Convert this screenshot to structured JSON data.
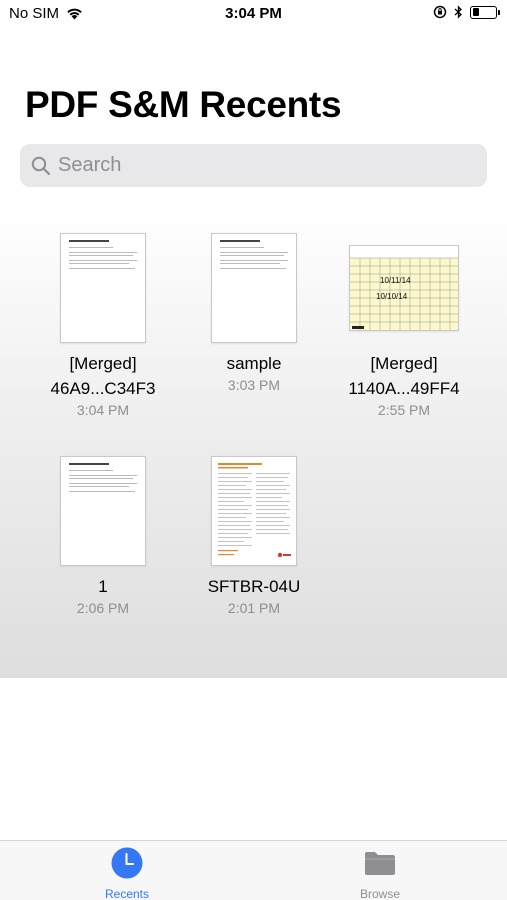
{
  "status_bar": {
    "carrier": "No SIM",
    "time": "3:04 PM",
    "battery_level": 0.3
  },
  "header": {
    "title": "PDF S&M Recents"
  },
  "search": {
    "placeholder": "Search",
    "value": ""
  },
  "files": [
    {
      "name_lines": [
        "[Merged]",
        "46A9...C34F3"
      ],
      "time": "3:04 PM",
      "thumb": "text-page"
    },
    {
      "name_lines": [
        "sample"
      ],
      "time": "3:03 PM",
      "thumb": "text-page"
    },
    {
      "name_lines": [
        "[Merged]",
        "1140A...49FF4"
      ],
      "time": "2:55 PM",
      "thumb": "spreadsheet",
      "thumb_text": [
        "10/11/14",
        "10/10/14"
      ]
    },
    {
      "name_lines": [
        "1"
      ],
      "time": "2:06 PM",
      "thumb": "text-page"
    },
    {
      "name_lines": [
        "SFTBR-04U"
      ],
      "time": "2:01 PM",
      "thumb": "form-page"
    }
  ],
  "tab_bar": {
    "tabs": [
      {
        "label": "Recents",
        "icon": "clock-icon",
        "active": true
      },
      {
        "label": "Browse",
        "icon": "folder-icon",
        "active": false
      }
    ],
    "active_color": "#3478f6",
    "inactive_color": "#8e8e93"
  }
}
